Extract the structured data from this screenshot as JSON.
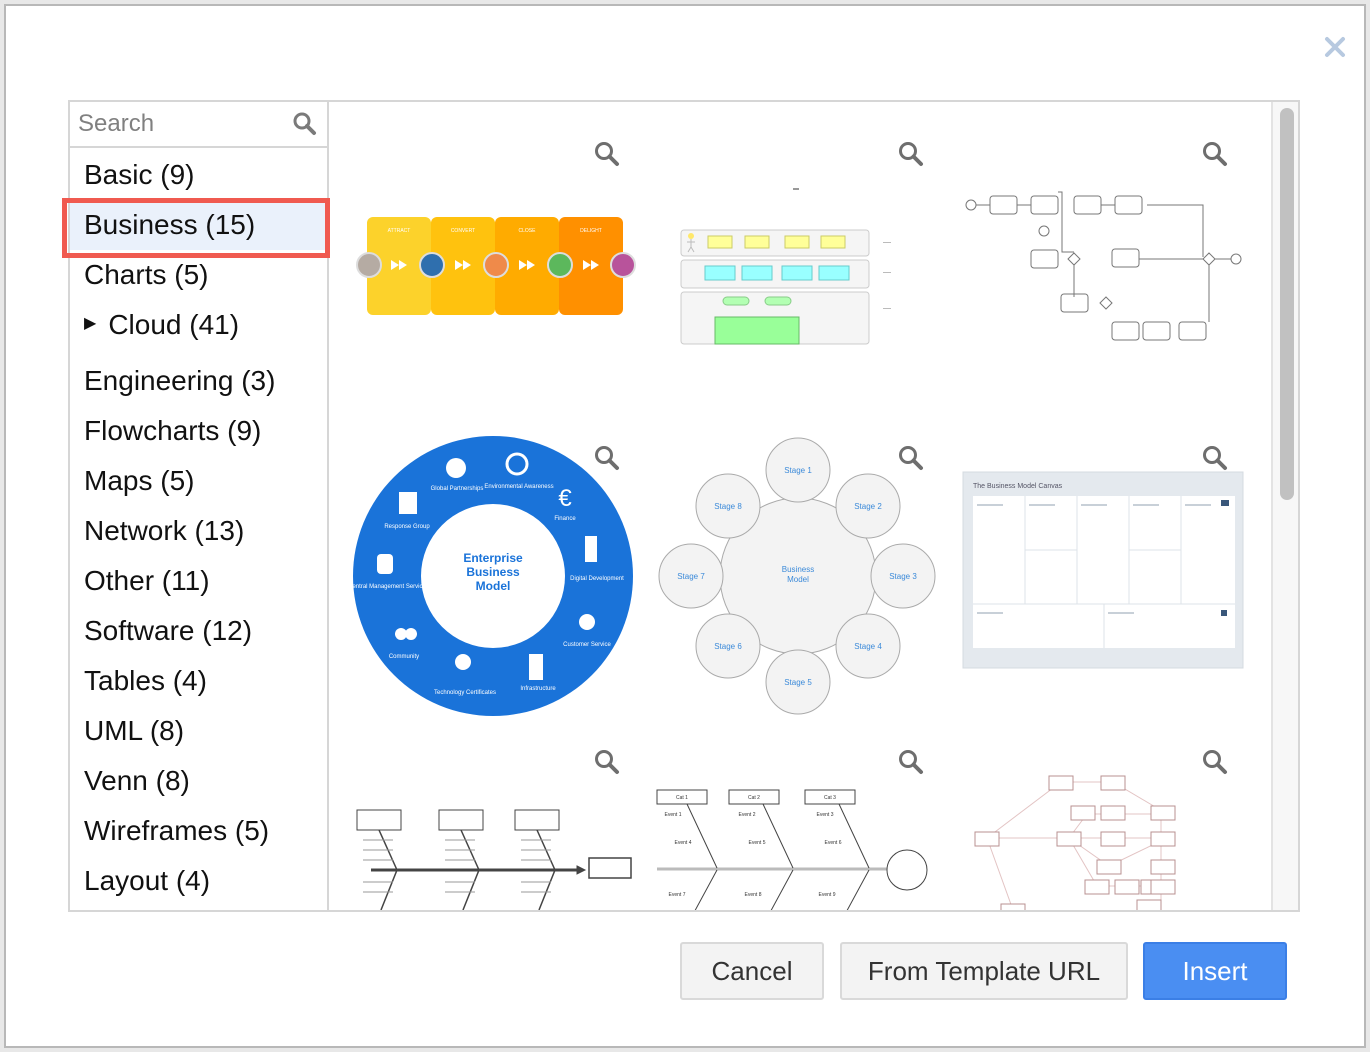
{
  "dialog": {
    "close_icon": "close-icon",
    "search": {
      "placeholder": "Search",
      "value": "",
      "icon": "search-icon"
    },
    "categories": [
      {
        "label": "Basic (9)",
        "selected": false
      },
      {
        "label": "Business (15)",
        "selected": true
      },
      {
        "label": "Charts (5)",
        "selected": false
      },
      {
        "label": "Cloud (41)",
        "selected": false,
        "expandable": true
      },
      {
        "label": "Engineering (3)",
        "selected": false
      },
      {
        "label": "Flowcharts (9)",
        "selected": false
      },
      {
        "label": "Maps (5)",
        "selected": false
      },
      {
        "label": "Network (13)",
        "selected": false
      },
      {
        "label": "Other (11)",
        "selected": false
      },
      {
        "label": "Software (12)",
        "selected": false
      },
      {
        "label": "Tables (4)",
        "selected": false
      },
      {
        "label": "UML (8)",
        "selected": false
      },
      {
        "label": "Venn (8)",
        "selected": false
      },
      {
        "label": "Wireframes (5)",
        "selected": false
      },
      {
        "label": "Layout (4)",
        "selected": false
      }
    ],
    "templates": [
      {
        "name": "inbound-marketing",
        "stages": [
          "ATTRACT",
          "CONVERT",
          "CLOSE",
          "DELIGHT"
        ]
      },
      {
        "name": "archimate-layers"
      },
      {
        "name": "bpmn-process"
      },
      {
        "name": "enterprise-business-model",
        "center": [
          "Enterprise",
          "Business",
          "Model"
        ],
        "segments": [
          "Global Partnerships",
          "Environmental Awareness",
          "Finance",
          "Digital Development",
          "Customer Service",
          "Infrastructure",
          "Technology Certificates",
          "Community",
          "Central Management Service",
          "Response Group"
        ]
      },
      {
        "name": "business-model-stages",
        "center": [
          "Business",
          "Model"
        ],
        "stages": [
          "Stage 1",
          "Stage 2",
          "Stage 3",
          "Stage 4",
          "Stage 5",
          "Stage 6",
          "Stage 7",
          "Stage 8"
        ]
      },
      {
        "name": "business-model-canvas",
        "title": "The Business Model Canvas"
      },
      {
        "name": "fishbone-1"
      },
      {
        "name": "fishbone-2",
        "causes": [
          "Cat 1",
          "Cat 2",
          "Cat 3"
        ],
        "events": [
          "Event 1",
          "Event 2",
          "Event 3",
          "Event 4",
          "Event 5",
          "Event 6",
          "Event 7",
          "Event 8",
          "Event 9"
        ]
      },
      {
        "name": "network-flow"
      }
    ],
    "scroll_position": 0,
    "buttons": {
      "cancel": "Cancel",
      "template_url": "From Template URL",
      "insert": "Insert"
    },
    "colors": {
      "accent": "#4a8ef2",
      "selection_outline": "#f05a50",
      "selection_bg": "#eaf1fb",
      "model_blue": "#1a73d9"
    }
  }
}
